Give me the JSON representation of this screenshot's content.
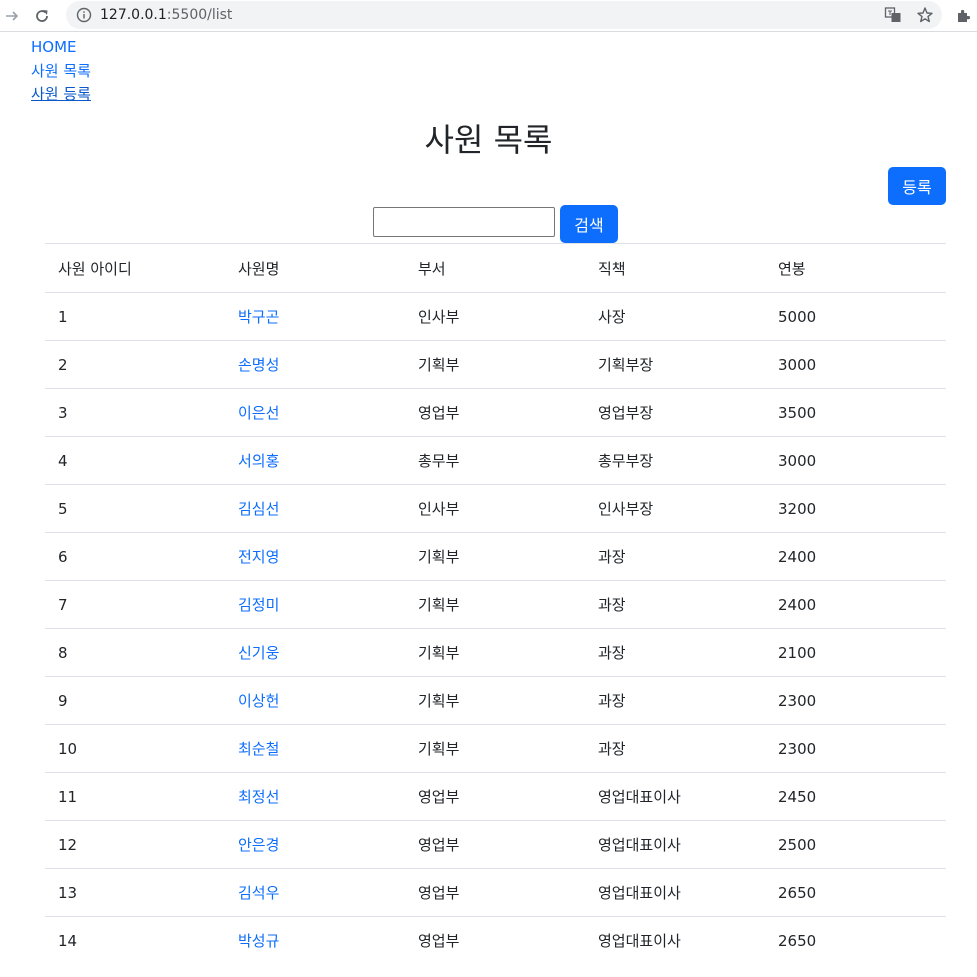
{
  "browser": {
    "url_host": "127.0.0.1",
    "url_path": ":5500/list"
  },
  "nav_links": [
    "HOME",
    "사원 목록",
    "사원 등록"
  ],
  "page_title": "사원 목록",
  "register_label": "등록",
  "search": {
    "value": "",
    "button_label": "검색"
  },
  "table": {
    "headers": [
      "사원 아이디",
      "사원명",
      "부서",
      "직책",
      "연봉"
    ],
    "rows": [
      [
        "1",
        "박구곤",
        "인사부",
        "사장",
        "5000"
      ],
      [
        "2",
        "손명성",
        "기획부",
        "기획부장",
        "3000"
      ],
      [
        "3",
        "이은선",
        "영업부",
        "영업부장",
        "3500"
      ],
      [
        "4",
        "서의홍",
        "총무부",
        "총무부장",
        "3000"
      ],
      [
        "5",
        "김심선",
        "인사부",
        "인사부장",
        "3200"
      ],
      [
        "6",
        "전지영",
        "기획부",
        "과장",
        "2400"
      ],
      [
        "7",
        "김정미",
        "기획부",
        "과장",
        "2400"
      ],
      [
        "8",
        "신기웅",
        "기획부",
        "과장",
        "2100"
      ],
      [
        "9",
        "이상헌",
        "기획부",
        "과장",
        "2300"
      ],
      [
        "10",
        "최순철",
        "기획부",
        "과장",
        "2300"
      ],
      [
        "11",
        "최정선",
        "영업부",
        "영업대표이사",
        "2450"
      ],
      [
        "12",
        "안은경",
        "영업부",
        "영업대표이사",
        "2500"
      ],
      [
        "13",
        "김석우",
        "영업부",
        "영업대표이사",
        "2650"
      ],
      [
        "14",
        "박성규",
        "영업부",
        "영업대표이사",
        "2650"
      ]
    ]
  }
}
